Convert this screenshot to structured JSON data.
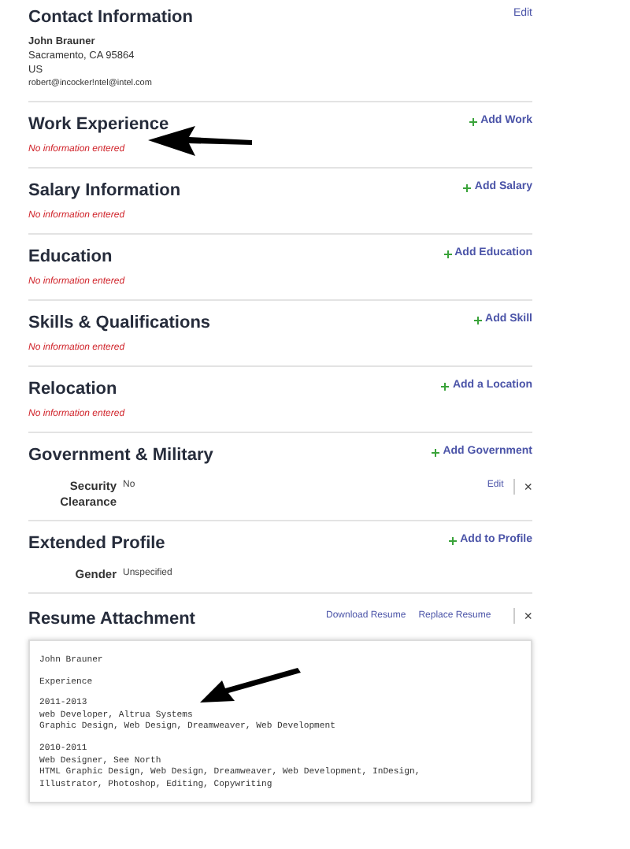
{
  "contact": {
    "title": "Contact Information",
    "action": "Edit",
    "name": "John Brauner",
    "lines": [
      "Sacramento, CA 95864",
      "US",
      "robert@incocker!ntel@intel.com"
    ]
  },
  "sections": [
    {
      "title": "Work Experience",
      "action": "Add Work",
      "kind": "empty",
      "message": "No information entered"
    },
    {
      "title": "Salary Information",
      "action": "Add Salary",
      "kind": "empty",
      "message": "No information entered"
    },
    {
      "title": "Education",
      "action": "Add Education",
      "kind": "empty",
      "message": "No information entered"
    },
    {
      "title": "Skills & Qualifications",
      "action": "Add Skill",
      "kind": "empty",
      "message": "No information entered"
    },
    {
      "title": "Relocation",
      "action": "Add a Location",
      "kind": "empty",
      "message": "No information entered"
    },
    {
      "title": "Government & Military",
      "action": "Add Government",
      "kind": "fields",
      "fields": [
        {
          "label": "Security Clearance",
          "value": "No",
          "edit": "Edit",
          "remove": "×"
        }
      ]
    },
    {
      "title": "Extended Profile",
      "action": "Add to Profile",
      "kind": "fields",
      "fields": [
        {
          "label": "Gender",
          "value": "Unspecified"
        }
      ]
    }
  ],
  "resume": {
    "title": "Resume Attachment",
    "actions": [
      "Download Resume",
      "Replace Resume"
    ],
    "remove": "×",
    "blocks": [
      [
        "John Brauner"
      ],
      [
        "Experience"
      ],
      [
        "2011-2013",
        "web Developer, Altrua Systems",
        "Graphic Design, Web Design, Dreamweaver, Web Development"
      ],
      [
        "2010-2011",
        "Web Designer, See North",
        "HTML Graphic Design, Web Design, Dreamweaver, Web Development, InDesign,",
        "Illustrator, Photoshop, Editing, Copywriting"
      ]
    ]
  }
}
